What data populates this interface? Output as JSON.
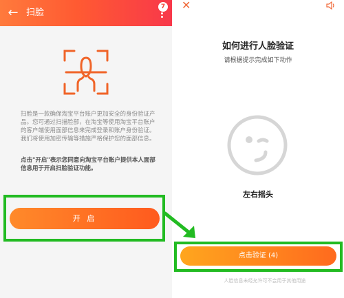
{
  "left_screen": {
    "header": {
      "back_icon": "arrow-left-icon",
      "title": "扫脸",
      "badge_count": "7",
      "menu_icon": "more-vertical-icon"
    },
    "face_icon": "face-scan-icon",
    "description": "扫脸是一款确保淘宝平台账户更加安全的身份验证产品。您可通过扫描脸部，在淘宝等使用淘宝平台账户的客户端使用面部信息来完成登录和账户身份验证。我们将使用加密传输等措施严格保护您的面部信息。",
    "consent_text": "点击\"开启\"表示您同意向淘宝平台账户提供本人面部信息用于开启扫脸验证功能。",
    "open_button": "开 启",
    "colors": {
      "header_start": "#ff7a3c",
      "header_end": "#f8384a",
      "button": "#ff5a1e",
      "highlight": "#22bb22"
    }
  },
  "right_screen": {
    "close_icon": "close-icon",
    "speaker_icon": "speaker-icon",
    "title": "如何进行人脸验证",
    "subtitle": "请根据提示完成如下动作",
    "face_illustration": "smiley-face-icon",
    "action": "左右摇头",
    "verify_button": "点击验证 (4)",
    "footnote": "人脸信息未经允许可不会用于其他用途",
    "colors": {
      "button_start": "#ffa61e",
      "button_end": "#ff6a1e",
      "highlight": "#22bb22"
    }
  }
}
